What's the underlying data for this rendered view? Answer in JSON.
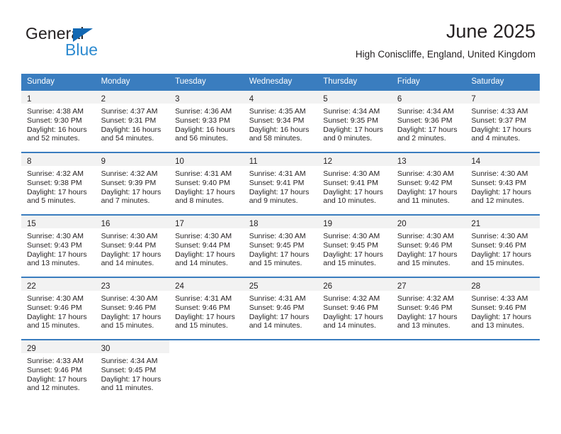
{
  "brand": {
    "name_primary": "General",
    "name_secondary": "Blue",
    "triangle_color": "#1268b3",
    "secondary_color": "#2e8bd0"
  },
  "header": {
    "title": "June 2025",
    "subtitle": "High Coniscliffe, England, United Kingdom"
  },
  "theme": {
    "header_row_bg": "#3a7dbf",
    "header_row_text": "#ffffff",
    "daynum_band_bg": "#f2f2f2",
    "text_color": "#231f20"
  },
  "calendar": {
    "weekday_headers": [
      "Sunday",
      "Monday",
      "Tuesday",
      "Wednesday",
      "Thursday",
      "Friday",
      "Saturday"
    ],
    "weeks": [
      [
        {
          "day": "1",
          "sunrise": "Sunrise: 4:38 AM",
          "sunset": "Sunset: 9:30 PM",
          "daylight_line1": "Daylight: 16 hours",
          "daylight_line2": "and 52 minutes."
        },
        {
          "day": "2",
          "sunrise": "Sunrise: 4:37 AM",
          "sunset": "Sunset: 9:31 PM",
          "daylight_line1": "Daylight: 16 hours",
          "daylight_line2": "and 54 minutes."
        },
        {
          "day": "3",
          "sunrise": "Sunrise: 4:36 AM",
          "sunset": "Sunset: 9:33 PM",
          "daylight_line1": "Daylight: 16 hours",
          "daylight_line2": "and 56 minutes."
        },
        {
          "day": "4",
          "sunrise": "Sunrise: 4:35 AM",
          "sunset": "Sunset: 9:34 PM",
          "daylight_line1": "Daylight: 16 hours",
          "daylight_line2": "and 58 minutes."
        },
        {
          "day": "5",
          "sunrise": "Sunrise: 4:34 AM",
          "sunset": "Sunset: 9:35 PM",
          "daylight_line1": "Daylight: 17 hours",
          "daylight_line2": "and 0 minutes."
        },
        {
          "day": "6",
          "sunrise": "Sunrise: 4:34 AM",
          "sunset": "Sunset: 9:36 PM",
          "daylight_line1": "Daylight: 17 hours",
          "daylight_line2": "and 2 minutes."
        },
        {
          "day": "7",
          "sunrise": "Sunrise: 4:33 AM",
          "sunset": "Sunset: 9:37 PM",
          "daylight_line1": "Daylight: 17 hours",
          "daylight_line2": "and 4 minutes."
        }
      ],
      [
        {
          "day": "8",
          "sunrise": "Sunrise: 4:32 AM",
          "sunset": "Sunset: 9:38 PM",
          "daylight_line1": "Daylight: 17 hours",
          "daylight_line2": "and 5 minutes."
        },
        {
          "day": "9",
          "sunrise": "Sunrise: 4:32 AM",
          "sunset": "Sunset: 9:39 PM",
          "daylight_line1": "Daylight: 17 hours",
          "daylight_line2": "and 7 minutes."
        },
        {
          "day": "10",
          "sunrise": "Sunrise: 4:31 AM",
          "sunset": "Sunset: 9:40 PM",
          "daylight_line1": "Daylight: 17 hours",
          "daylight_line2": "and 8 minutes."
        },
        {
          "day": "11",
          "sunrise": "Sunrise: 4:31 AM",
          "sunset": "Sunset: 9:41 PM",
          "daylight_line1": "Daylight: 17 hours",
          "daylight_line2": "and 9 minutes."
        },
        {
          "day": "12",
          "sunrise": "Sunrise: 4:30 AM",
          "sunset": "Sunset: 9:41 PM",
          "daylight_line1": "Daylight: 17 hours",
          "daylight_line2": "and 10 minutes."
        },
        {
          "day": "13",
          "sunrise": "Sunrise: 4:30 AM",
          "sunset": "Sunset: 9:42 PM",
          "daylight_line1": "Daylight: 17 hours",
          "daylight_line2": "and 11 minutes."
        },
        {
          "day": "14",
          "sunrise": "Sunrise: 4:30 AM",
          "sunset": "Sunset: 9:43 PM",
          "daylight_line1": "Daylight: 17 hours",
          "daylight_line2": "and 12 minutes."
        }
      ],
      [
        {
          "day": "15",
          "sunrise": "Sunrise: 4:30 AM",
          "sunset": "Sunset: 9:43 PM",
          "daylight_line1": "Daylight: 17 hours",
          "daylight_line2": "and 13 minutes."
        },
        {
          "day": "16",
          "sunrise": "Sunrise: 4:30 AM",
          "sunset": "Sunset: 9:44 PM",
          "daylight_line1": "Daylight: 17 hours",
          "daylight_line2": "and 14 minutes."
        },
        {
          "day": "17",
          "sunrise": "Sunrise: 4:30 AM",
          "sunset": "Sunset: 9:44 PM",
          "daylight_line1": "Daylight: 17 hours",
          "daylight_line2": "and 14 minutes."
        },
        {
          "day": "18",
          "sunrise": "Sunrise: 4:30 AM",
          "sunset": "Sunset: 9:45 PM",
          "daylight_line1": "Daylight: 17 hours",
          "daylight_line2": "and 15 minutes."
        },
        {
          "day": "19",
          "sunrise": "Sunrise: 4:30 AM",
          "sunset": "Sunset: 9:45 PM",
          "daylight_line1": "Daylight: 17 hours",
          "daylight_line2": "and 15 minutes."
        },
        {
          "day": "20",
          "sunrise": "Sunrise: 4:30 AM",
          "sunset": "Sunset: 9:46 PM",
          "daylight_line1": "Daylight: 17 hours",
          "daylight_line2": "and 15 minutes."
        },
        {
          "day": "21",
          "sunrise": "Sunrise: 4:30 AM",
          "sunset": "Sunset: 9:46 PM",
          "daylight_line1": "Daylight: 17 hours",
          "daylight_line2": "and 15 minutes."
        }
      ],
      [
        {
          "day": "22",
          "sunrise": "Sunrise: 4:30 AM",
          "sunset": "Sunset: 9:46 PM",
          "daylight_line1": "Daylight: 17 hours",
          "daylight_line2": "and 15 minutes."
        },
        {
          "day": "23",
          "sunrise": "Sunrise: 4:30 AM",
          "sunset": "Sunset: 9:46 PM",
          "daylight_line1": "Daylight: 17 hours",
          "daylight_line2": "and 15 minutes."
        },
        {
          "day": "24",
          "sunrise": "Sunrise: 4:31 AM",
          "sunset": "Sunset: 9:46 PM",
          "daylight_line1": "Daylight: 17 hours",
          "daylight_line2": "and 15 minutes."
        },
        {
          "day": "25",
          "sunrise": "Sunrise: 4:31 AM",
          "sunset": "Sunset: 9:46 PM",
          "daylight_line1": "Daylight: 17 hours",
          "daylight_line2": "and 14 minutes."
        },
        {
          "day": "26",
          "sunrise": "Sunrise: 4:32 AM",
          "sunset": "Sunset: 9:46 PM",
          "daylight_line1": "Daylight: 17 hours",
          "daylight_line2": "and 14 minutes."
        },
        {
          "day": "27",
          "sunrise": "Sunrise: 4:32 AM",
          "sunset": "Sunset: 9:46 PM",
          "daylight_line1": "Daylight: 17 hours",
          "daylight_line2": "and 13 minutes."
        },
        {
          "day": "28",
          "sunrise": "Sunrise: 4:33 AM",
          "sunset": "Sunset: 9:46 PM",
          "daylight_line1": "Daylight: 17 hours",
          "daylight_line2": "and 13 minutes."
        }
      ],
      [
        {
          "day": "29",
          "sunrise": "Sunrise: 4:33 AM",
          "sunset": "Sunset: 9:46 PM",
          "daylight_line1": "Daylight: 17 hours",
          "daylight_line2": "and 12 minutes."
        },
        {
          "day": "30",
          "sunrise": "Sunrise: 4:34 AM",
          "sunset": "Sunset: 9:45 PM",
          "daylight_line1": "Daylight: 17 hours",
          "daylight_line2": "and 11 minutes."
        },
        {
          "day": "",
          "sunrise": "",
          "sunset": "",
          "daylight_line1": "",
          "daylight_line2": ""
        },
        {
          "day": "",
          "sunrise": "",
          "sunset": "",
          "daylight_line1": "",
          "daylight_line2": ""
        },
        {
          "day": "",
          "sunrise": "",
          "sunset": "",
          "daylight_line1": "",
          "daylight_line2": ""
        },
        {
          "day": "",
          "sunrise": "",
          "sunset": "",
          "daylight_line1": "",
          "daylight_line2": ""
        },
        {
          "day": "",
          "sunrise": "",
          "sunset": "",
          "daylight_line1": "",
          "daylight_line2": ""
        }
      ]
    ]
  }
}
